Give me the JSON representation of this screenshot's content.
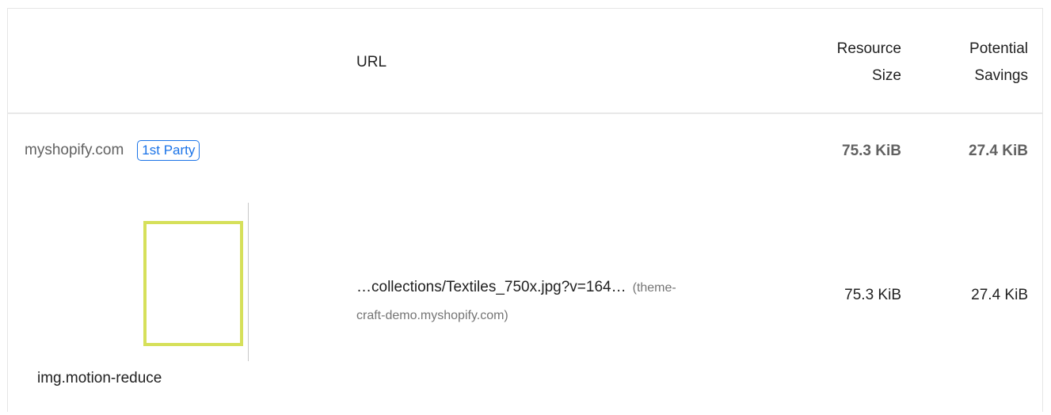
{
  "header": {
    "url_label": "URL",
    "size_label_line1": "Resource",
    "size_label_line2": "Size",
    "savings_label_line1": "Potential",
    "savings_label_line2": "Savings"
  },
  "entity": {
    "name": "myshopify.com",
    "badge": "1st Party",
    "resource_size": "75.3 KiB",
    "potential_savings": "27.4 KiB"
  },
  "item": {
    "selector": "img.motion-reduce",
    "url": "…collections/Textiles_750x.jpg?v=164…",
    "origin_part1": "(theme-",
    "origin_part2": "craft-demo.myshopify.com)",
    "resource_size": "75.3 KiB",
    "potential_savings": "27.4 KiB",
    "thumbnail_accent": "#d6e05a"
  },
  "colors": {
    "badge": "#1a73e8",
    "muted_text": "#616161"
  }
}
